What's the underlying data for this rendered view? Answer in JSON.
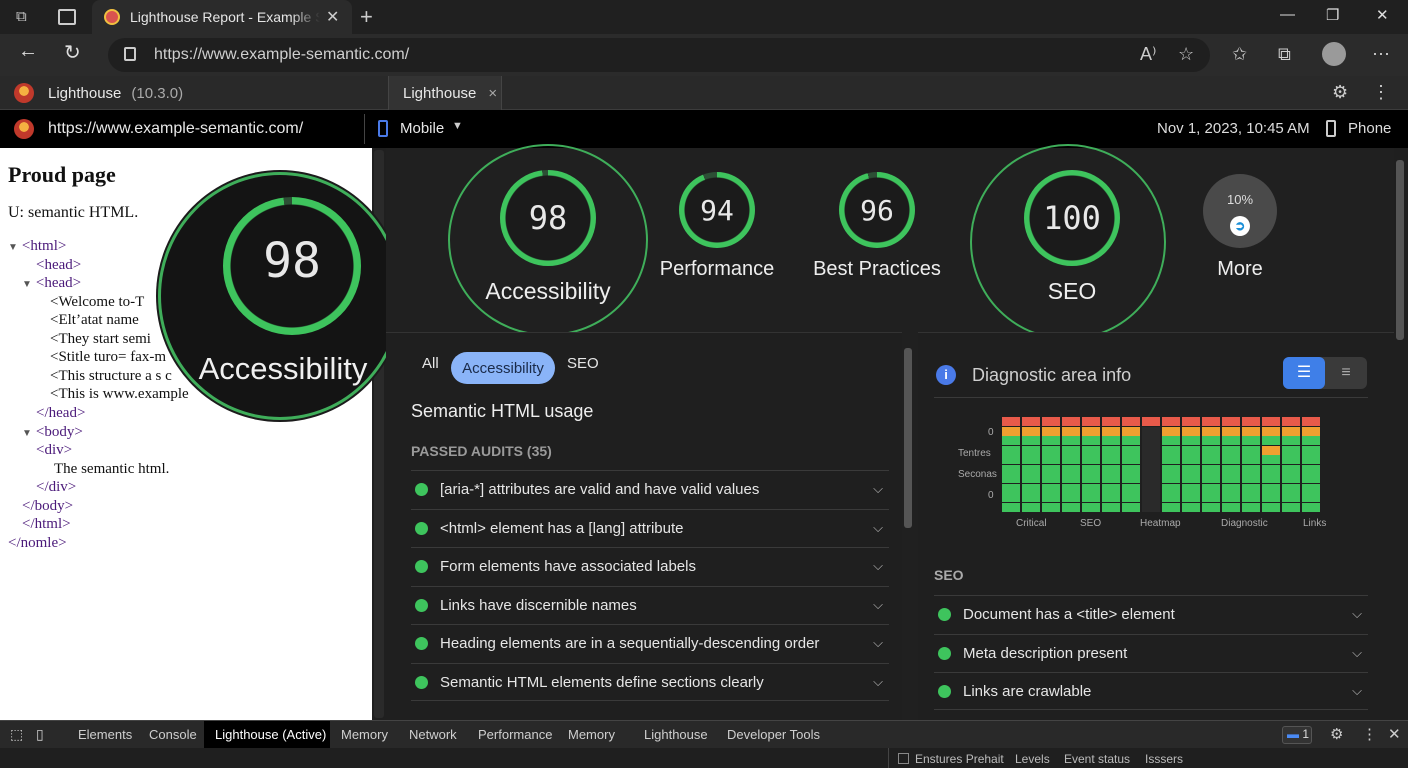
{
  "browser": {
    "tab_title": "Lighthouse Report - Example Semantic",
    "url": "https://www.example-semantic.com/",
    "new_tab_symbol": "+",
    "close_symbol": "✕"
  },
  "devtools": {
    "app_name": "Lighthouse",
    "version": "(10.3.0)",
    "panel_tab": "Lighthouse",
    "report_url": "https://www.example-semantic.com/",
    "device": "Mobile",
    "timestamp": "Nov 1, 2023, 10:45 AM",
    "device_right": "Phone"
  },
  "preview": {
    "title": "Proud page",
    "subtitle": "U: semantic HTML.",
    "lines": [
      "<html>",
      "<head>",
      "<head>",
      "<Welcome to-T",
      "<Elt’atat name",
      "<They start semi",
      "<Stitle turo= fax-m",
      "<This structure a s c",
      "<This is www.example",
      "</head>",
      "<body>",
      "<div>",
      "The semantic html.",
      "</div>",
      "</body>",
      "</html>",
      "</nomle>"
    ]
  },
  "zoom": {
    "score": "98",
    "label": "Accessibility"
  },
  "scores": [
    {
      "score": "98",
      "label": "Accessibility",
      "value": 98
    },
    {
      "score": "94",
      "label": "Performance",
      "value": 94
    },
    {
      "score": "96",
      "label": "Best Practices",
      "value": 96
    },
    {
      "score": "100",
      "label": "SEO",
      "value": 100
    },
    {
      "score": "10%",
      "label": "More"
    }
  ],
  "audits": {
    "filters": [
      "All",
      "Accessibility",
      "SEO"
    ],
    "section_title": "Semantic HTML usage",
    "passed_header": "PASSED AUDITS (35)",
    "items": [
      "[aria-*] attributes are valid and have valid values",
      "<html> element has a [lang] attribute",
      "Form elements have associated labels",
      "Links have discernible names",
      "Heading elements are in a sequentially-descending order",
      "Semantic HTML elements define sections clearly"
    ]
  },
  "diagnostic": {
    "title": "Diagnostic area info",
    "y_labels": [
      "0",
      "Tentres",
      "Seconas",
      "0"
    ],
    "x_labels": [
      "Critical",
      "SEO",
      "Heatmap",
      "Diagnostic",
      "Links"
    ],
    "seo_header": "SEO",
    "seo_items": [
      "Document has a <title> element",
      "Meta description present",
      "Links are crawlable"
    ]
  },
  "bottom_tabs": [
    "Elements",
    "Console",
    "Lighthouse (Active)",
    "Memory",
    "Network",
    "Performance",
    "Memory",
    "Lighthouse",
    "Developer Tools"
  ],
  "issues_count": "1",
  "status_items": [
    "Enstures Prehait",
    "Levels",
    "Event status",
    "Isssers"
  ],
  "colors": {
    "pass": "#3ec45d",
    "accent": "#8ab4f8",
    "warn": "#f0a030",
    "fail": "#e85a4a"
  }
}
